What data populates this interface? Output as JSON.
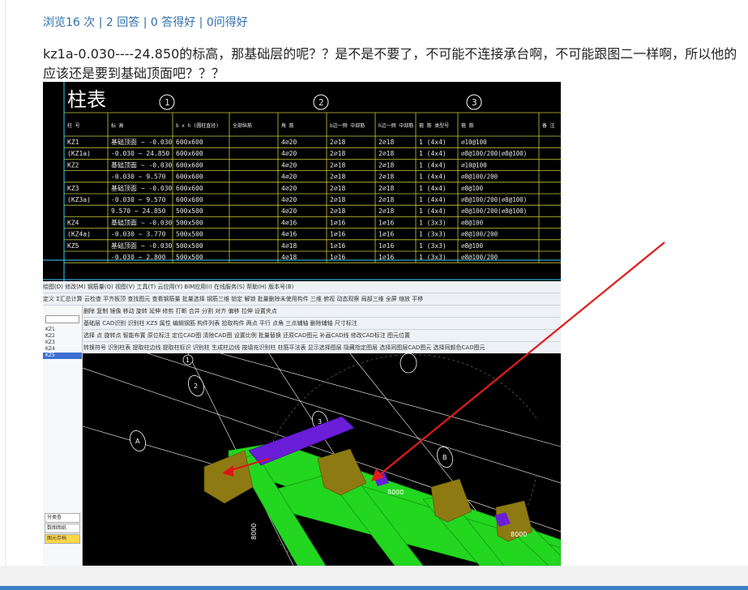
{
  "stats": {
    "views": "浏览16 次",
    "answers": "2 回答",
    "good_answers": "0 答得好",
    "good_questions": "0问得好",
    "sep": " | "
  },
  "question": {
    "text": "kz1a-0.030----24.850的标高，那基础层的呢？？是不是不要了，不可能不连接承台啊，不可能跟图二一样啊，所以他的应该还是要到基础顶面吧？？？"
  },
  "table_image": {
    "title": "柱表",
    "axis_marks": [
      "1",
      "2",
      "3"
    ],
    "headers": [
      "柱 号",
      "标 高",
      "b x h (圆柱直径)",
      "全部纵筋",
      "角 筋",
      "b边一侧 中部筋",
      "h边一侧 中部筋",
      "箍 筋 类型号",
      "箍 筋",
      "备 注"
    ],
    "rows": [
      [
        "KZ1",
        "基础顶面 ~ -0.030",
        "600x600",
        "",
        "4⌀20",
        "2⌀18",
        "2⌀18",
        "1 (4x4)",
        "⌀10@100",
        ""
      ],
      [
        "(KZ1a)",
        "-0.030 ~ 24.850",
        "600x600",
        "",
        "4⌀20",
        "2⌀18",
        "2⌀18",
        "1 (4x4)",
        "⌀8@100/200(⌀8@100)",
        ""
      ],
      [
        "KZ2",
        "基础顶面 ~ -0.030",
        "600x600",
        "",
        "4⌀20",
        "2⌀18",
        "2⌀18",
        "1 (4x4)",
        "⌀10@100",
        ""
      ],
      [
        "",
        "-0.030 ~ 9.570",
        "600x600",
        "",
        "4⌀20",
        "2⌀18",
        "2⌀18",
        "1 (4x4)",
        "⌀8@100/200",
        ""
      ],
      [
        "KZ3",
        "基础顶面 ~ -0.030",
        "600x600",
        "",
        "4⌀20",
        "2⌀18",
        "2⌀18",
        "1 (4x4)",
        "⌀8@100",
        ""
      ],
      [
        "(KZ3a)",
        "-0.030 ~ 9.570",
        "600x600",
        "",
        "4⌀20",
        "2⌀18",
        "2⌀18",
        "1 (4x4)",
        "⌀8@100/200(⌀8@100)",
        ""
      ],
      [
        "",
        "9.570 ~ 24.850",
        "500x500",
        "",
        "4⌀20",
        "2⌀18",
        "2⌀18",
        "1 (4x4)",
        "⌀8@100/200(⌀8@100)",
        ""
      ],
      [
        "KZ4",
        "基础顶面 ~ -0.030",
        "500x500",
        "",
        "4⌀16",
        "1⌀16",
        "1⌀16",
        "1 (3x3)",
        "⌀8@100",
        ""
      ],
      [
        "(KZ4a)",
        "-0.030 ~ 3.770",
        "500x500",
        "",
        "4⌀16",
        "1⌀16",
        "1⌀16",
        "1 (3x3)",
        "⌀8@100/200",
        ""
      ],
      [
        "KZ5",
        "基础顶面 ~ -0.030",
        "500x500",
        "",
        "4⌀18",
        "1⌀16",
        "1⌀16",
        "1 (3x3)",
        "⌀8@100",
        ""
      ],
      [
        "",
        "-0.030 ~ 2.800",
        "500x500",
        "",
        "4⌀18",
        "1⌀16",
        "1⌀16",
        "1 (3x3)",
        "⌀8@100/200",
        ""
      ]
    ]
  },
  "app_image": {
    "menu": "绘图(D)  修改(M)  钢筋量(Q)  视图(V)  工具(T)  云应用(Y)  BIM应用(I)  在线服务(S)  帮助(H)  版本号(B)",
    "toolbar1": "定义  Σ汇总计算  云检查  平齐板顶  查找图元  查看钢筋量  批量选择  钢筋三维  锁定  解锁  批量删除未使用构件  三维  俯视  动态观察  局部三维  全屏  缩放  平移",
    "toolbar2": "删除  复制  镜像  移动  旋转  延伸  修剪  打断  合并  分割  对齐  偏移  拉伸  设置夹点",
    "toolbar3": "基础层  CAD识别  识别柱  KZ5  属性  编辑钢筋  构件列表  拾取构件  两点  平行  点角  三点辅轴  删除辅轴  尺寸标注",
    "toolbar4": "选择  点  旋转点  智能布置  原位标注  定位CAD图  清除CAD图  设置比例  批量替换  还原CAD图元  补画CAD线  修改CAD标注  图元位置",
    "toolbar5": "转换符号  识别柱表  提取柱边线  提取柱标识  识别柱  生成柱边线  按填充识别柱  柱筋平法表  显示选择图层  隐藏指定图层  选择同图层CAD图元  选择同颜色CAD图元",
    "side_labels": [
      "KZ1",
      "KZ2",
      "KZ3",
      "KZ4",
      "KZ5"
    ],
    "side_tabs": [
      "分类查",
      "数图图纸",
      "图元存档"
    ],
    "grid_labels": [
      "1",
      "2",
      "3",
      "B",
      "A"
    ],
    "dim_labels": [
      "8000",
      "8000",
      "8000"
    ],
    "colors": {
      "beam": "#23d61f",
      "column_cap": "#8e7a12",
      "purple_column": "#6a1ed8",
      "grid": "#ffffff",
      "arrow": "#e01414"
    }
  },
  "colors": {
    "link": "#2f6fb0",
    "text": "#222222",
    "scrollbar": "#3d7fc6"
  }
}
